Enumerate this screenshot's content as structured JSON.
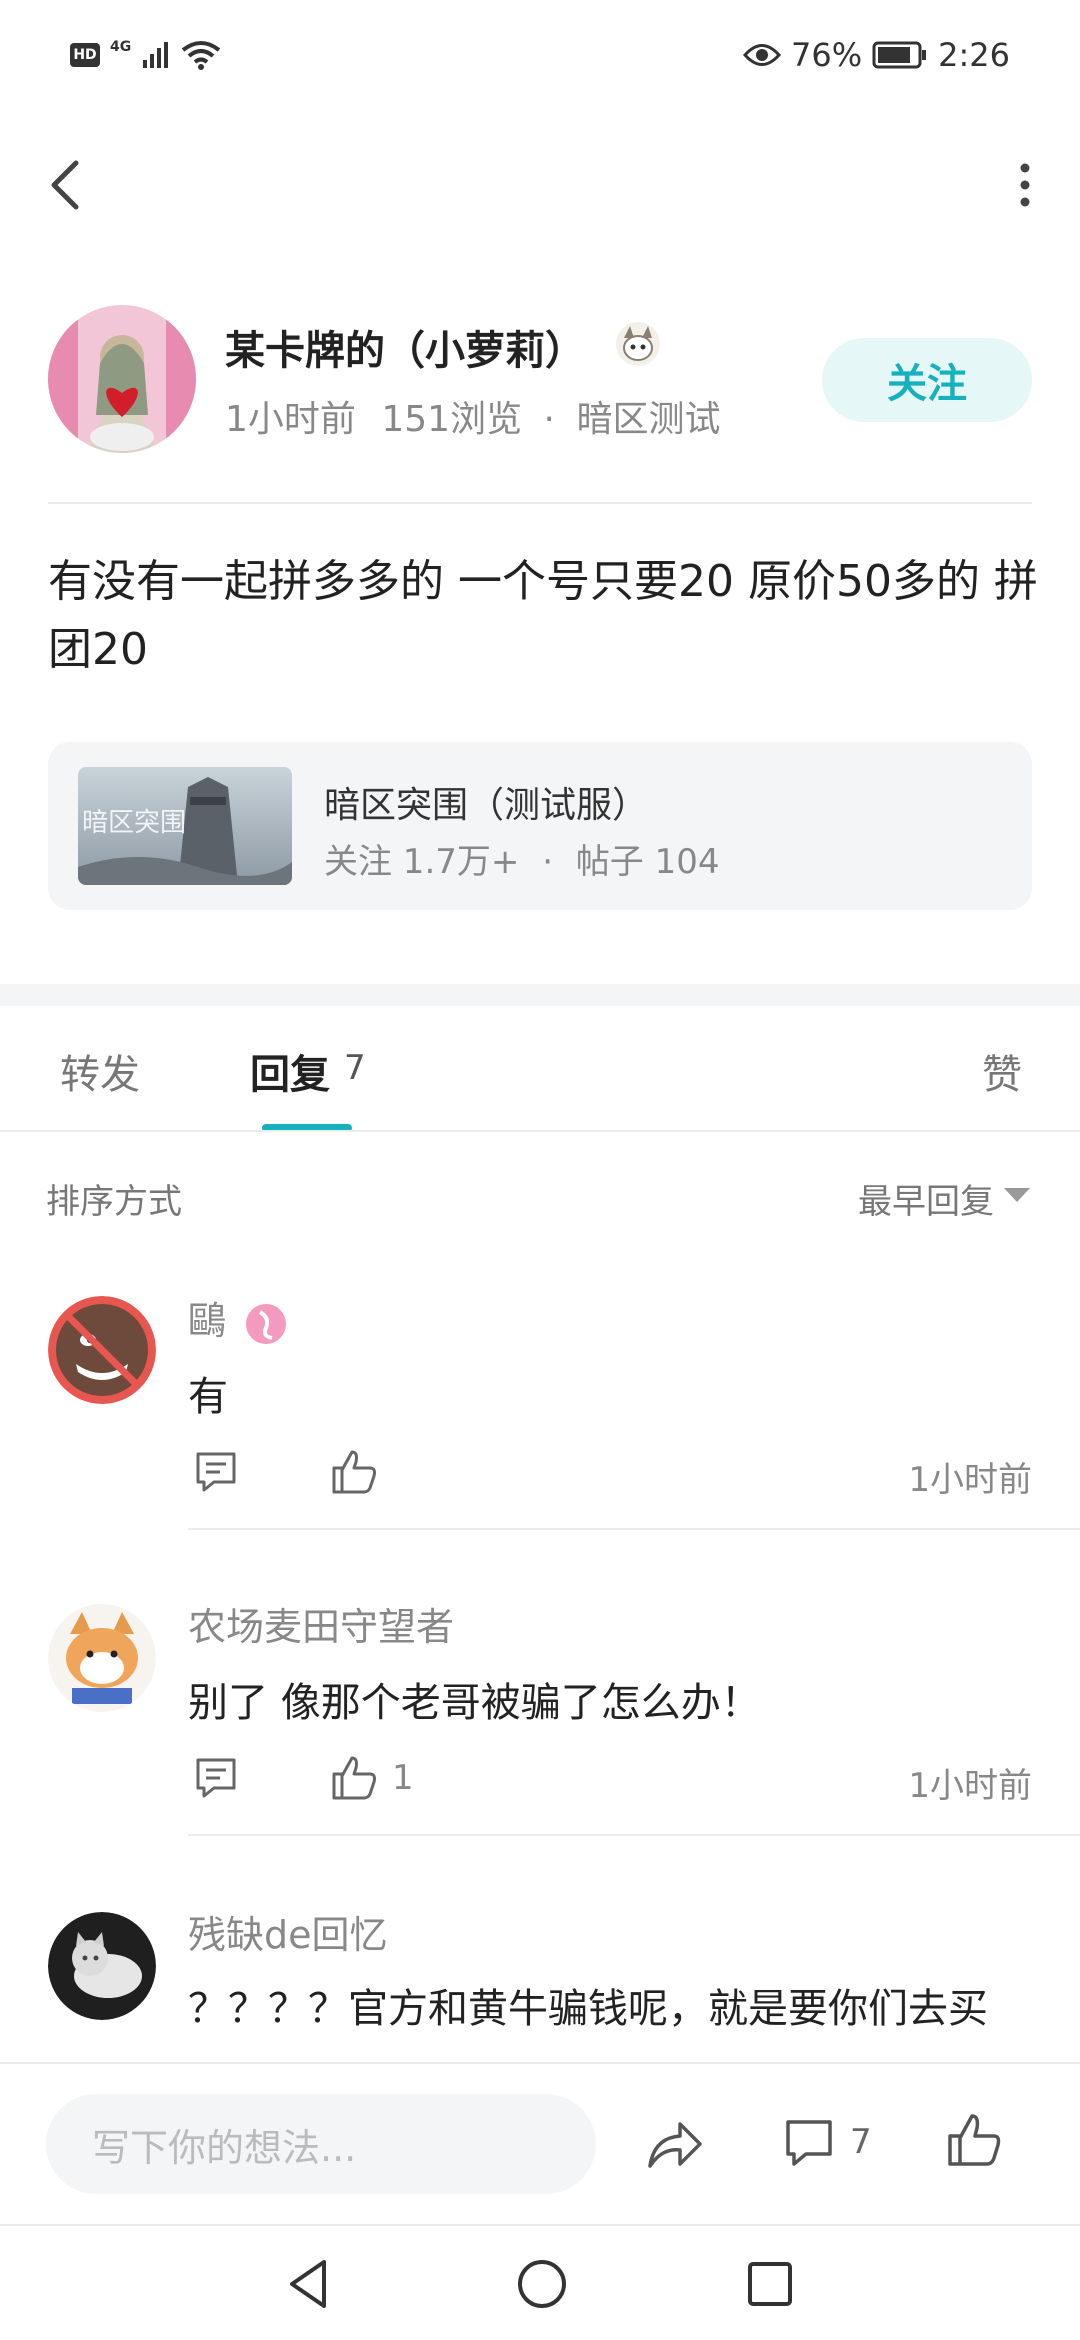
{
  "status_bar": {
    "network": "4G",
    "battery": "76%",
    "time": "2:26"
  },
  "post": {
    "author_name": "某卡牌的（小萝莉）",
    "time_ago": "1小时前",
    "views": "151浏览",
    "circle_tag": "暗区测试",
    "follow_label": "关注",
    "content": "有没有一起拼多多的 一个号只要20 原价50多的 拼团20"
  },
  "circle": {
    "name": "暗区突围（测试服）",
    "followers": "关注 1.7万+",
    "posts": "帖子 104",
    "thumb_text": "暗区突围"
  },
  "tabs": {
    "repost": "转发",
    "reply": "回复",
    "reply_count": "7",
    "like": "赞"
  },
  "sort": {
    "label": "排序方式",
    "value": "最早回复"
  },
  "comments": [
    {
      "user": "鷗",
      "text": "有",
      "likes": "",
      "time": "1小时前"
    },
    {
      "user": "农场麦田守望者",
      "text": "别了  像那个老哥被骗了怎么办！",
      "likes": "1",
      "time": "1小时前"
    },
    {
      "user": "残缺de回忆",
      "text": "？？？？官方和黄牛骗钱呢，就是要你们去买"
    }
  ],
  "bottom_bar": {
    "input_placeholder": "写下你的想法...",
    "comment_count": "7"
  },
  "colors": {
    "accent": "#17b1bd",
    "follow_bg": "#e6f7f8",
    "card_bg": "#f4f5f7"
  }
}
